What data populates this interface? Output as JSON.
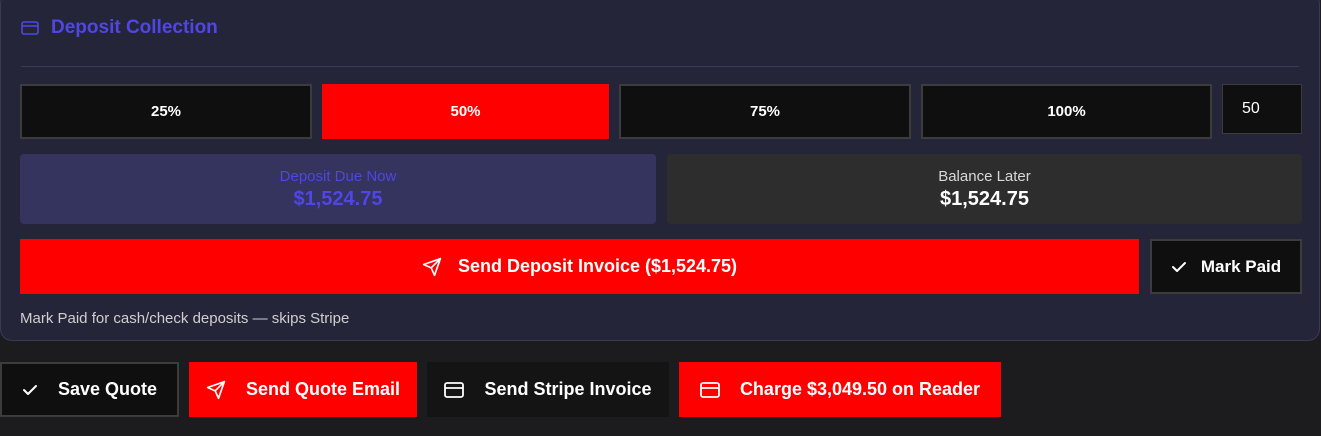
{
  "panel": {
    "title": "Deposit Collection",
    "title_icon": "credit-card-icon"
  },
  "percent_options": [
    {
      "label": "25%",
      "selected": false
    },
    {
      "label": "50%",
      "selected": true
    },
    {
      "label": "75%",
      "selected": false
    },
    {
      "label": "100%",
      "selected": false
    }
  ],
  "custom_percent": {
    "value": "50"
  },
  "deposit_due": {
    "label": "Deposit Due Now",
    "amount": "$1,524.75"
  },
  "balance_later": {
    "label": "Balance Later",
    "amount": "$1,524.75"
  },
  "send_deposit_button": {
    "label": "Send Deposit Invoice ($1,524.75)",
    "icon": "send-icon"
  },
  "mark_paid_button": {
    "label": "Mark Paid",
    "icon": "check-icon"
  },
  "hint": "Mark Paid for cash/check deposits — skips Stripe",
  "actions": {
    "save_quote": {
      "label": "Save Quote",
      "icon": "check-icon"
    },
    "send_quote_email": {
      "label": "Send Quote Email",
      "icon": "send-icon"
    },
    "send_stripe_invoice": {
      "label": "Send Stripe Invoice",
      "icon": "credit-card-icon"
    },
    "charge_reader": {
      "label": "Charge $3,049.50 on Reader",
      "icon": "credit-card-icon"
    }
  },
  "colors": {
    "accent": "#4f46e5",
    "primary_red": "#ff0000",
    "panel_bg": "#25253a",
    "page_bg": "#1c1c1e"
  }
}
